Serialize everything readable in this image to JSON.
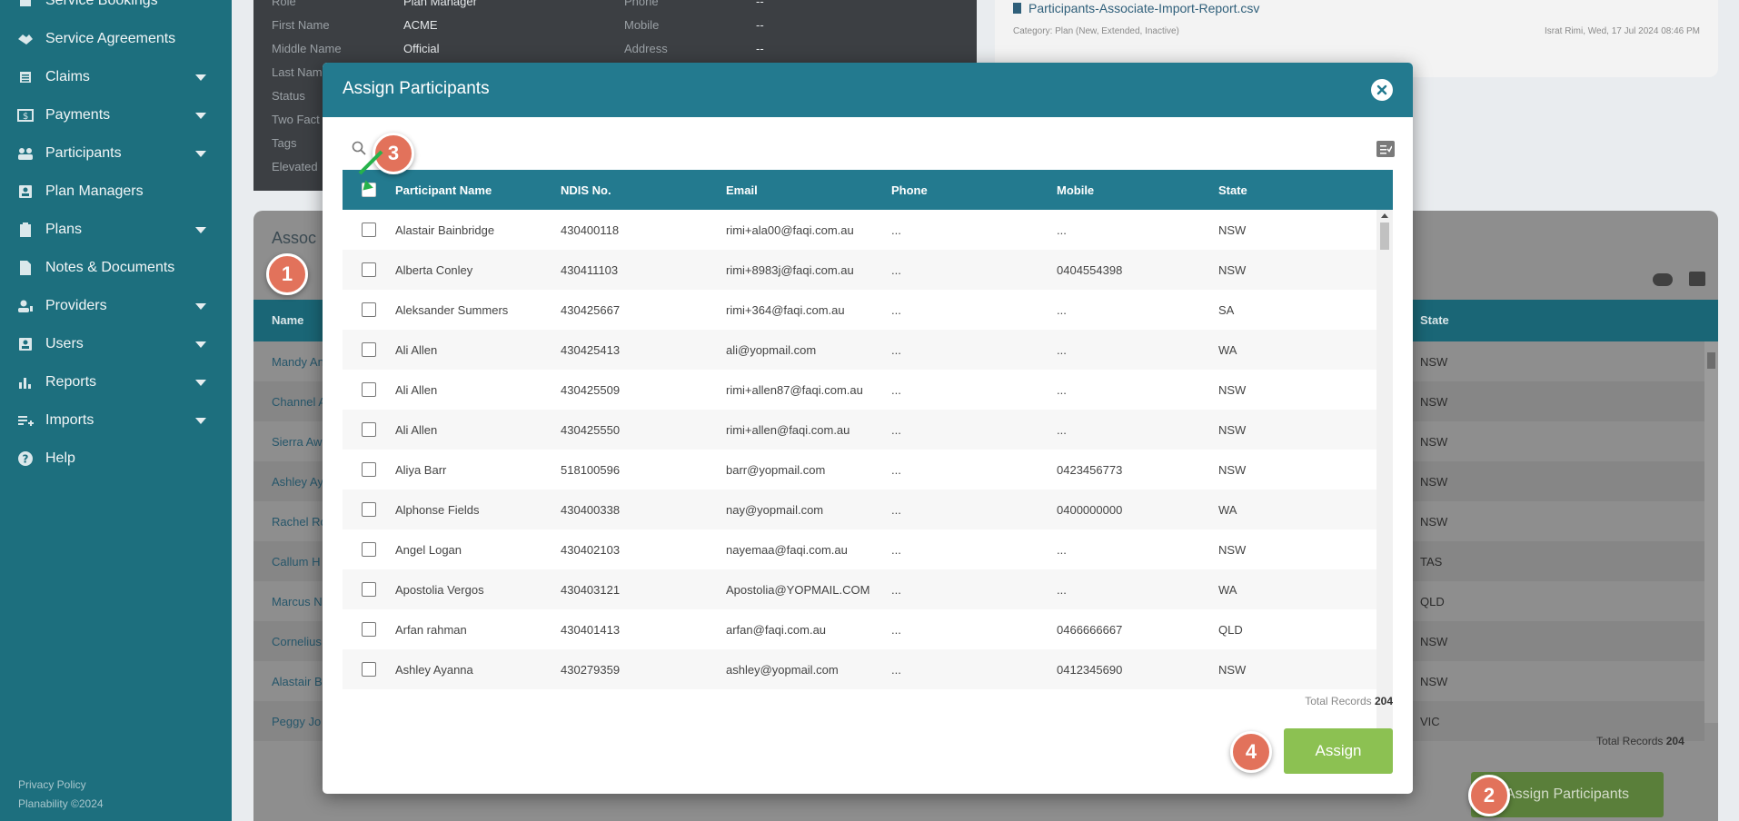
{
  "sidebar": {
    "items": [
      {
        "label": "Service Bookings",
        "icon": "calendar-icon"
      },
      {
        "label": "Service Agreements",
        "icon": "handshake-icon"
      },
      {
        "label": "Claims",
        "icon": "list-icon"
      },
      {
        "label": "Payments",
        "icon": "money-icon"
      },
      {
        "label": "Participants",
        "icon": "people-icon"
      },
      {
        "label": "Plan Managers",
        "icon": "badge-icon"
      },
      {
        "label": "Plans",
        "icon": "clipboard-icon"
      },
      {
        "label": "Notes & Documents",
        "icon": "document-icon"
      },
      {
        "label": "Providers",
        "icon": "provider-icon"
      },
      {
        "label": "Users",
        "icon": "user-icon"
      },
      {
        "label": "Reports",
        "icon": "bar-chart-icon"
      },
      {
        "label": "Imports",
        "icon": "import-icon"
      },
      {
        "label": "Help",
        "icon": "help-icon"
      }
    ],
    "footer": {
      "privacy": "Privacy Policy",
      "copyright": "Planability ©2024"
    }
  },
  "background": {
    "details": {
      "role_label": "Role",
      "role_value": "Plan Manager",
      "first_name_label": "First Name",
      "first_name_value": "ACME",
      "middle_name_label": "Middle Name",
      "middle_name_value": "Official",
      "last_name_label": "Last Nam",
      "status_label": "Status",
      "two_factor_label": "Two Fact",
      "tags_label": "Tags",
      "elevated_label": "Elevated",
      "phone_label": "Phone",
      "phone_value": "--",
      "mobile_label": "Mobile",
      "mobile_value": "--",
      "address_label": "Address",
      "address_value": "--"
    },
    "file": {
      "name": "Participants-Associate-Import-Report.csv",
      "category": "Category: Plan (New, Extended, Inactive)",
      "meta": "Israt Rimi, Wed, 17 Jul 2024 08:46 PM"
    },
    "section_title": "Assoc",
    "table_header": {
      "name": "Name",
      "state": "State"
    },
    "rows": [
      {
        "name": "Mandy An",
        "state": "NSW"
      },
      {
        "name": "Channel A",
        "state": "NSW"
      },
      {
        "name": "Sierra Aw",
        "state": "NSW"
      },
      {
        "name": "Ashley Ay",
        "state": "NSW"
      },
      {
        "name": "Rachel Ro",
        "state": "NSW"
      },
      {
        "name": "Callum H",
        "state": "TAS"
      },
      {
        "name": "Marcus N",
        "state": "QLD"
      },
      {
        "name": "Cornelius",
        "state": "NSW"
      },
      {
        "name": "Alastair B",
        "state": "NSW"
      },
      {
        "name": "Peggy Jo",
        "state": "VIC"
      }
    ],
    "total_label": "Total Records",
    "total_value": "204",
    "assign_participants_label": "Assign Participants"
  },
  "modal": {
    "title": "Assign Participants",
    "columns": {
      "name": "Participant Name",
      "ndis": "NDIS No.",
      "email": "Email",
      "phone": "Phone",
      "mobile": "Mobile",
      "state": "State"
    },
    "rows": [
      {
        "name": "Alastair Bainbridge",
        "ndis": "430400118",
        "email": "rimi+ala00@faqi.com.au",
        "phone": "...",
        "mobile": "...",
        "state": "NSW"
      },
      {
        "name": "Alberta Conley",
        "ndis": "430411103",
        "email": "rimi+8983j@faqi.com.au",
        "phone": "...",
        "mobile": "0404554398",
        "state": "NSW"
      },
      {
        "name": "Aleksander Summers",
        "ndis": "430425667",
        "email": "rimi+364@faqi.com.au",
        "phone": "...",
        "mobile": "...",
        "state": "SA"
      },
      {
        "name": "Ali Allen",
        "ndis": "430425413",
        "email": "ali@yopmail.com",
        "phone": "...",
        "mobile": "...",
        "state": "WA"
      },
      {
        "name": "Ali Allen",
        "ndis": "430425509",
        "email": "rimi+allen87@faqi.com.au",
        "phone": "...",
        "mobile": "...",
        "state": "NSW"
      },
      {
        "name": "Ali Allen",
        "ndis": "430425550",
        "email": "rimi+allen@faqi.com.au",
        "phone": "...",
        "mobile": "...",
        "state": "NSW"
      },
      {
        "name": "Aliya Barr",
        "ndis": "518100596",
        "email": "barr@yopmail.com",
        "phone": "...",
        "mobile": "0423456773",
        "state": "NSW"
      },
      {
        "name": "Alphonse Fields",
        "ndis": "430400338",
        "email": "nay@yopmail.com",
        "phone": "...",
        "mobile": "0400000000",
        "state": "WA"
      },
      {
        "name": "Angel Logan",
        "ndis": "430402103",
        "email": "nayemaa@faqi.com.au",
        "phone": "...",
        "mobile": "...",
        "state": "NSW"
      },
      {
        "name": "Apostolia Vergos",
        "ndis": "430403121",
        "email": "Apostolia@YOPMAIL.COM",
        "phone": "...",
        "mobile": "...",
        "state": "WA"
      },
      {
        "name": "Arfan rahman",
        "ndis": "430401413",
        "email": "arfan@faqi.com.au",
        "phone": "...",
        "mobile": "0466666667",
        "state": "QLD"
      },
      {
        "name": "Ashley Ayanna",
        "ndis": "430279359",
        "email": "ashley@yopmail.com",
        "phone": "...",
        "mobile": "0412345690",
        "state": "NSW"
      }
    ],
    "total_label": "Total Records",
    "total_value": "204",
    "assign_label": "Assign"
  },
  "steps": [
    "1",
    "2",
    "3",
    "4"
  ],
  "colors": {
    "sidebar": "#1d6f7e",
    "header": "#237a8f",
    "assign": "#8cc152",
    "step": "#e2725b"
  }
}
